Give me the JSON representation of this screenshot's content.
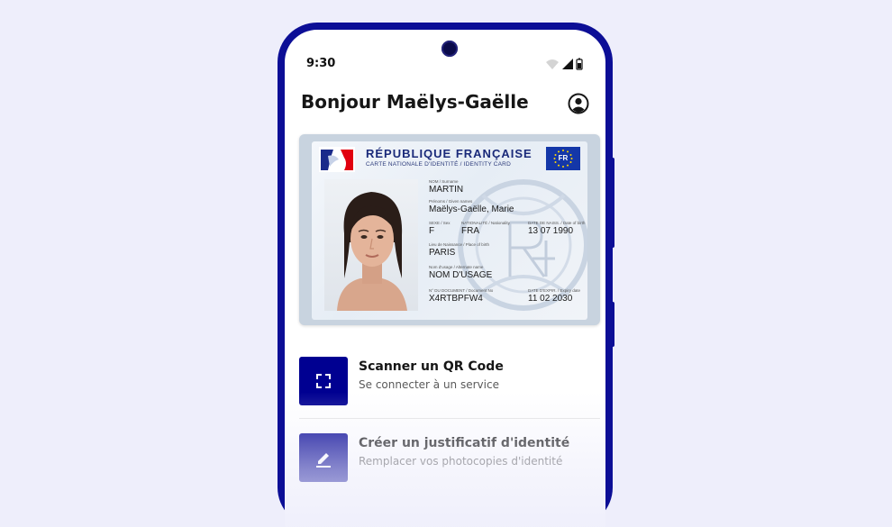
{
  "status_bar": {
    "time": "9:30",
    "icons": [
      "wifi-icon",
      "signal-icon",
      "battery-icon"
    ]
  },
  "header": {
    "title": "Bonjour Maëlys-Gaëlle",
    "account_icon": "account-icon"
  },
  "id_card": {
    "country": "RÉPUBLIQUE FRANÇAISE",
    "subtitle": "CARTE NATIONALE D'IDENTITÉ / IDENTITY CARD",
    "eu_code": "FR",
    "fields": {
      "surname_label": "NOM / Surname",
      "surname": "MARTIN",
      "given_label": "Prénoms / Given names",
      "given": "Maëlys-Gaëlle, Marie",
      "sex_label": "SEXE / Sex",
      "sex": "F",
      "nationality_label": "NATIONALITÉ / Nationality",
      "nationality": "FRA",
      "dob_label": "DATE DE NAISS. / Date of birth",
      "dob": "13 07 1990",
      "pob_label": "Lieu de Naissance / Place of birth",
      "pob": "PARIS",
      "usage_label": "Nom d'usage / Alternate name",
      "usage": "NOM D'USAGE",
      "docno_label": "N° DU DOCUMENT / Document No",
      "docno": "X4RTBPFW4",
      "expiry_label": "DATE D'EXPIR. / Expiry date",
      "expiry": "11 02 2030"
    }
  },
  "actions": [
    {
      "title": "Scanner un QR Code",
      "subtitle": "Se connecter à un service",
      "icon": "qr-scan-icon"
    },
    {
      "title": "Créer un justificatif d'identité",
      "subtitle": "Remplacer vos photocopies d'identité",
      "icon": "edit-pencil-icon"
    }
  ],
  "colors": {
    "brand_blue": "#000091",
    "phone_frame": "#0c0e96",
    "background": "#eeeefb"
  }
}
